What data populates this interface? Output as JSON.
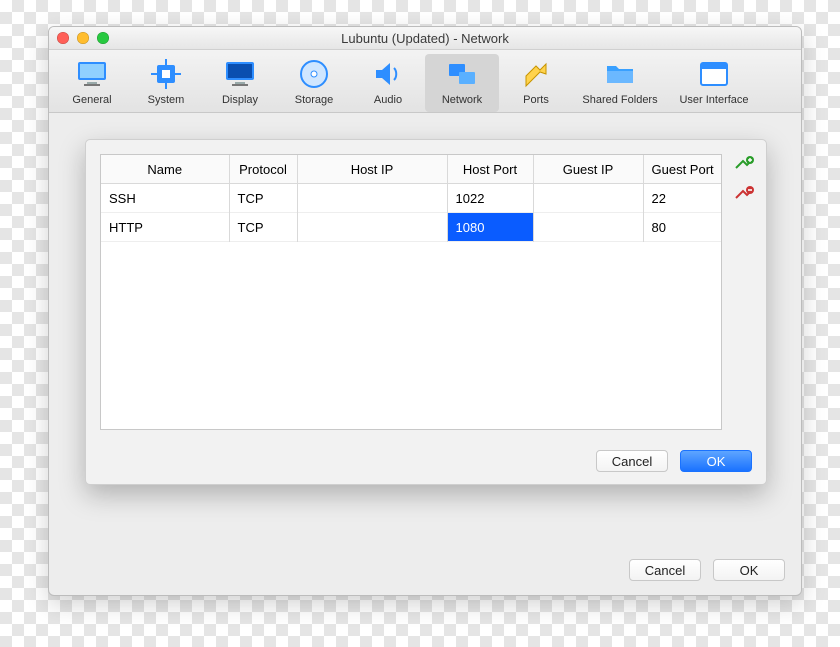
{
  "window": {
    "title": "Lubuntu (Updated) - Network"
  },
  "toolbar": {
    "items": [
      {
        "label": "General"
      },
      {
        "label": "System"
      },
      {
        "label": "Display"
      },
      {
        "label": "Storage"
      },
      {
        "label": "Audio"
      },
      {
        "label": "Network"
      },
      {
        "label": "Ports"
      },
      {
        "label": "Shared Folders"
      },
      {
        "label": "User Interface"
      }
    ],
    "selected_index": 5
  },
  "port_forwarding": {
    "columns": [
      "Name",
      "Protocol",
      "Host IP",
      "Host Port",
      "Guest IP",
      "Guest Port"
    ],
    "rows": [
      {
        "name": "SSH",
        "protocol": "TCP",
        "host_ip": "",
        "host_port": "1022",
        "guest_ip": "",
        "guest_port": "22"
      },
      {
        "name": "HTTP",
        "protocol": "TCP",
        "host_ip": "",
        "host_port": "1080",
        "guest_ip": "",
        "guest_port": "80"
      }
    ],
    "selected_cell": {
      "row": 1,
      "col": "host_port"
    }
  },
  "buttons": {
    "cancel": "Cancel",
    "ok": "OK"
  }
}
